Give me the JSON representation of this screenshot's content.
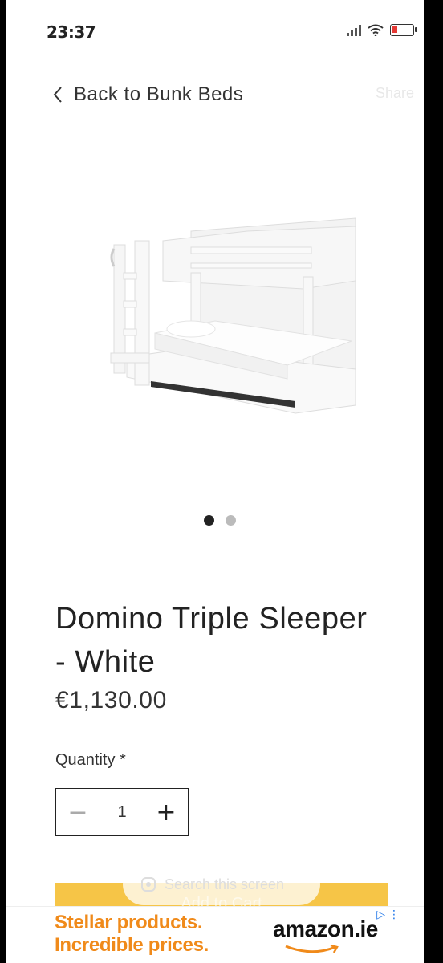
{
  "status_bar": {
    "time": "23:37"
  },
  "nav": {
    "back_label": "Back to Bunk Beds",
    "share_label": "Share"
  },
  "gallery": {
    "dots_total": 2,
    "active_index": 0
  },
  "product": {
    "title": "Domino Triple Sleeper - White",
    "price": "€1,130.00",
    "quantity_label": "Quantity *",
    "quantity": "1"
  },
  "actions": {
    "add_to_cart": "Add to Cart",
    "search_screen": "Search this screen"
  },
  "ad": {
    "line1": "Stellar products.",
    "line2": "Incredible prices.",
    "brand": "amazon.ie",
    "brand_color": "#f08a1a"
  }
}
